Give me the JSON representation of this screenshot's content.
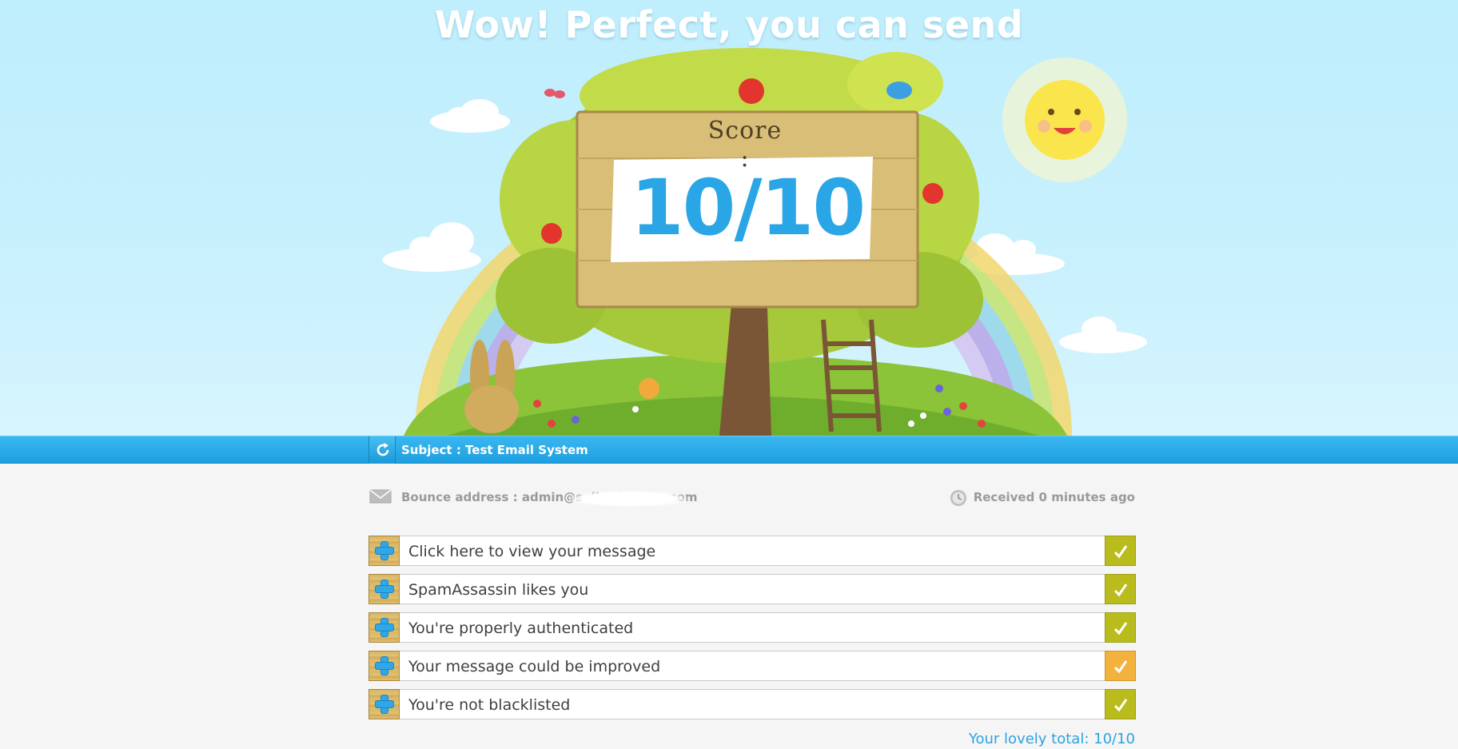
{
  "hero": {
    "headline": "Wow! Perfect, you can send",
    "score_label": "Score :",
    "score_value": "10/10"
  },
  "subject_bar": {
    "refresh_icon": "refresh-icon",
    "subject": "Subject : Test Email System"
  },
  "info": {
    "bounce": "Bounce address : admin@s     dbo    f  r    a  on.com",
    "received": "Received 0 minutes ago",
    "bounce_icon": "envelope-icon",
    "received_icon": "clock-icon"
  },
  "checks": [
    {
      "label": "Click here to view your message",
      "status": "ok",
      "color": "#b9bc1c"
    },
    {
      "label": "SpamAssassin likes you",
      "status": "ok",
      "color": "#b9bc1c"
    },
    {
      "label": "You're properly authenticated",
      "status": "ok",
      "color": "#b9bc1c"
    },
    {
      "label": "Your message could be improved",
      "status": "warning",
      "color": "#f3b13d"
    },
    {
      "label": "You're not blacklisted",
      "status": "ok",
      "color": "#b9bc1c"
    }
  ],
  "total": "Your lovely total: 10/10",
  "colors": {
    "accent": "#2aa6e6",
    "ok": "#b9bc1c",
    "warning": "#f3b13d",
    "subject_bar": "#1e9fe0"
  }
}
